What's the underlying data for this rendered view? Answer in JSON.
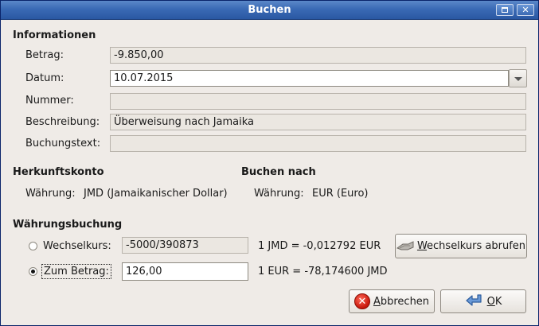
{
  "window": {
    "title": "Buchen"
  },
  "informationen": {
    "heading": "Informationen",
    "betrag_label": "Betrag:",
    "betrag_value": "-9.850,00",
    "datum_label": "Datum:",
    "datum_value": "10.07.2015",
    "nummer_label": "Nummer:",
    "nummer_value": "",
    "beschreibung_label": "Beschreibung:",
    "beschreibung_value": "Überweisung nach Jamaika",
    "buchungstext_label": "Buchungstext:",
    "buchungstext_value": ""
  },
  "herkunft": {
    "heading": "Herkunftskonto",
    "waehrung_label": "Währung:",
    "waehrung_value": "JMD (Jamaikanischer Dollar)"
  },
  "ziel": {
    "heading": "Buchen nach",
    "waehrung_label": "Währung:",
    "waehrung_value": "EUR (Euro)"
  },
  "waehrungsbuchung": {
    "heading": "Währungsbuchung",
    "wechselkurs_label": "Wechselkurs:",
    "wechselkurs_value": "-5000/390873",
    "wechselkurs_info": "1 JMD = -0,012792 EUR",
    "wechselkurs_selected": false,
    "zum_betrag_label": "Zum Betrag:",
    "zum_betrag_value": "126,00",
    "zum_betrag_info": "1 EUR = -78,174600 JMD",
    "zum_betrag_selected": true,
    "abrufen_button_mnemonic": "W",
    "abrufen_button_rest": "echselkurs abrufen"
  },
  "buttons": {
    "abbrechen_mnemonic": "A",
    "abbrechen_rest": "bbrechen",
    "ok_mnemonic": "O",
    "ok_rest": "K"
  },
  "icons": {
    "maximize": "maximize-icon",
    "close": "close-icon",
    "exchange": "exchange-icon",
    "cancel": "cancel-icon",
    "ok": "ok-arrow-icon"
  }
}
